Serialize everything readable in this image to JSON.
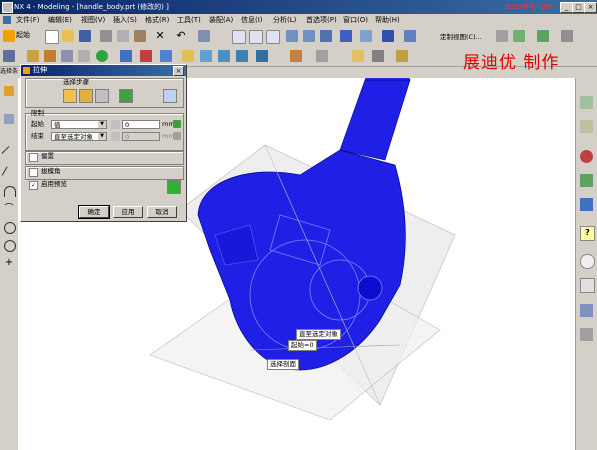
{
  "window": {
    "title": "NX 4 - Modeling - [handle_body.prt (修改的) ]",
    "clock": "2013年4月20日"
  },
  "menu": [
    "文件(F)",
    "编辑(E)",
    "视图(V)",
    "插入(S)",
    "格式(R)",
    "工具(T)",
    "装配(A)",
    "信息(I)",
    "分析(L)",
    "首选项(P)",
    "窗口(O)",
    "帮助(H)"
  ],
  "toolbar": {
    "start_label": "起始",
    "view_label": "定制视图(C)..."
  },
  "watermark": "展迪优  制作",
  "selection_bar": {
    "label": "选择条"
  },
  "dialog": {
    "title": "拉伸",
    "steps_label": "选择步骤",
    "limits_label": "限制",
    "start_label": "起始",
    "start_option": "值",
    "start_value": "0",
    "start_unit": "mm",
    "end_label": "结束",
    "end_option": "直至选定对象",
    "end_value": "0",
    "end_unit": "mm",
    "offset_label": "偏置",
    "draft_label": "拔模角",
    "preview_label": "启用预览",
    "ok": "确定",
    "apply": "应用",
    "cancel": "取消"
  },
  "canvas_labels": {
    "until_selected": "直至选定对象",
    "start_value": "起始=0",
    "select_section": "选择剖面"
  },
  "colors": {
    "model": "#1f1fe6",
    "title": "#0a246a",
    "watermark": "#e00000"
  }
}
